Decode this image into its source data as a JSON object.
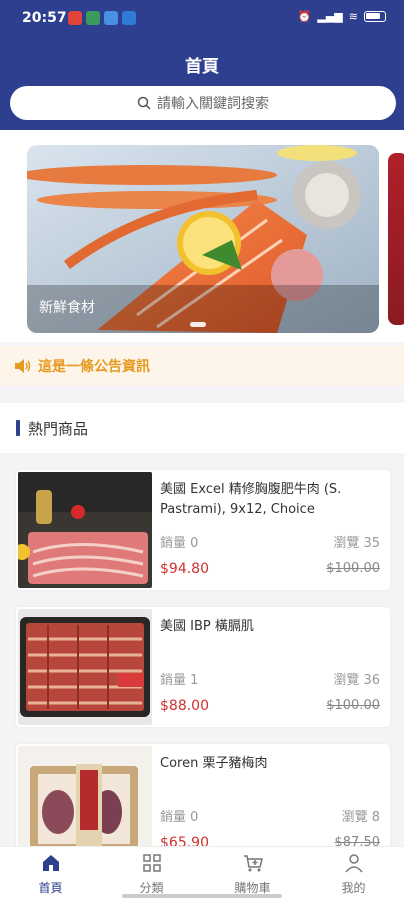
{
  "status": {
    "time": "20:57",
    "app_colors": [
      "#e2433b",
      "#3a9b5c",
      "#4a90e2",
      "#2f7bd8"
    ]
  },
  "header": {
    "title": "首頁"
  },
  "search": {
    "placeholder": "請輸入關鍵詞搜索"
  },
  "banner": {
    "caption": "新鮮食材"
  },
  "notice": {
    "text": "這是一條公告資訊"
  },
  "section": {
    "title": "熱門商品"
  },
  "products": [
    {
      "name": "美國 Excel 精修胸腹肥牛肉 (S. Pastrami), 9x12, Choice",
      "sales": "銷量 0",
      "views": "瀏覽 35",
      "price": "$94.80",
      "original": "$100.00"
    },
    {
      "name": "美國 IBP 橫膈肌",
      "sales": "銷量 1",
      "views": "瀏覽 36",
      "price": "$88.00",
      "original": "$100.00"
    },
    {
      "name": "Coren 栗子豬梅肉",
      "sales": "銷量 0",
      "views": "瀏覽 8",
      "price": "$65.90",
      "original": "$87.50"
    }
  ],
  "tabs": [
    {
      "label": "首頁",
      "icon": "home-icon"
    },
    {
      "label": "分類",
      "icon": "grid-icon"
    },
    {
      "label": "購物車",
      "icon": "cart-icon"
    },
    {
      "label": "我的",
      "icon": "user-icon"
    }
  ],
  "colors": {
    "brand": "#2f3f8f",
    "price": "#d23030",
    "notice": "#e79a1f"
  }
}
